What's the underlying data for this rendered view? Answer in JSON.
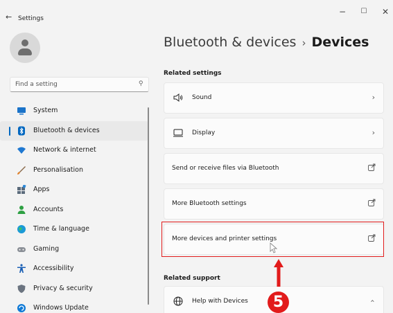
{
  "window": {
    "title": "Settings",
    "controls": {
      "minimize": "−",
      "maximize": "☐",
      "close": "✕"
    }
  },
  "search": {
    "placeholder": "Find a setting"
  },
  "sidebar": {
    "items": [
      {
        "label": "System",
        "icon": "monitor-icon",
        "color": "#1a73c9"
      },
      {
        "label": "Bluetooth & devices",
        "icon": "bluetooth-icon",
        "color": "#0067c0",
        "active": true
      },
      {
        "label": "Network & internet",
        "icon": "wifi-icon",
        "color": "#1f78d1"
      },
      {
        "label": "Personalisation",
        "icon": "brush-icon",
        "color": "#e0822d"
      },
      {
        "label": "Apps",
        "icon": "apps-icon",
        "color": "#5b6b7b"
      },
      {
        "label": "Accounts",
        "icon": "accounts-icon",
        "color": "#2ea043"
      },
      {
        "label": "Time & language",
        "icon": "globe-icon",
        "color": "#1b9ad6"
      },
      {
        "label": "Gaming",
        "icon": "gamepad-icon",
        "color": "#8a8f96"
      },
      {
        "label": "Accessibility",
        "icon": "accessibility-icon",
        "color": "#1a5fb4"
      },
      {
        "label": "Privacy & security",
        "icon": "shield-icon",
        "color": "#6b7480"
      },
      {
        "label": "Windows Update",
        "icon": "update-icon",
        "color": "#0f7ad6"
      }
    ]
  },
  "breadcrumb": {
    "parent": "Bluetooth & devices",
    "separator": "›",
    "current": "Devices"
  },
  "related_settings": {
    "heading": "Related settings",
    "items": [
      {
        "label": "Sound",
        "icon": "speaker-icon",
        "action": "chevron"
      },
      {
        "label": "Display",
        "icon": "display-icon",
        "action": "chevron"
      },
      {
        "label": "Send or receive files via Bluetooth",
        "action": "external"
      },
      {
        "label": "More Bluetooth settings",
        "action": "external"
      },
      {
        "label": "More devices and printer settings",
        "action": "external",
        "highlighted": true
      }
    ]
  },
  "related_support": {
    "heading": "Related support",
    "items": [
      {
        "label": "Help with Devices",
        "icon": "globe-icon",
        "action": "collapse"
      }
    ]
  },
  "annotation": {
    "step": "5",
    "color": "#e21b1b"
  }
}
